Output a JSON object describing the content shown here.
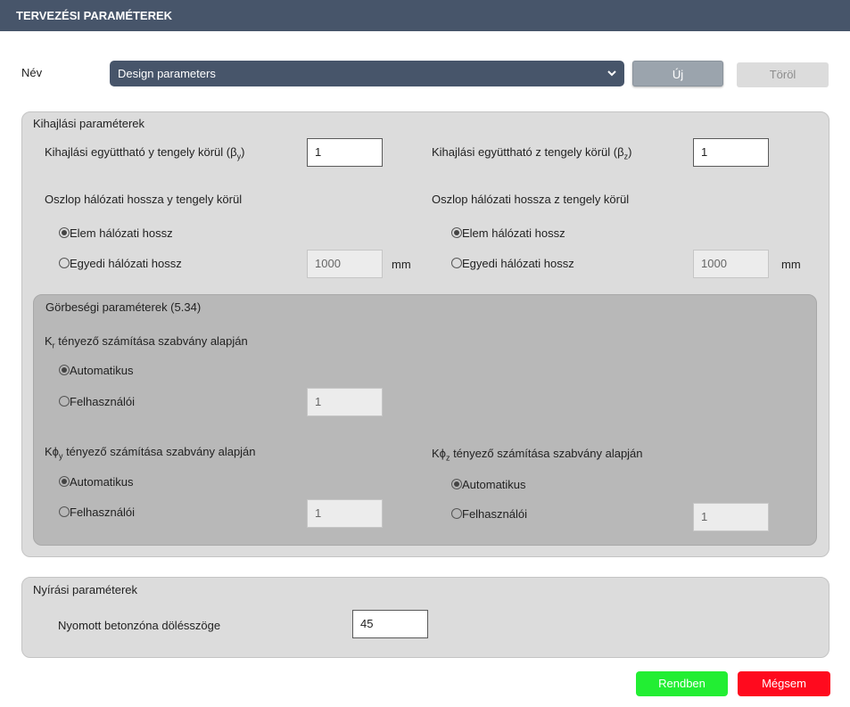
{
  "window": {
    "title": "TERVEZÉSI PARAMÉTEREK"
  },
  "name_row": {
    "label": "Név",
    "value": "Design parameters",
    "new_button": "Új",
    "delete_button": "Töröl"
  },
  "buckling": {
    "group_title": "Kihajlási paraméterek",
    "beta_y": {
      "label_prefix": "Kihajlási együttható y tengely körül (β",
      "sub": "y",
      "label_suffix": ")",
      "value": "1"
    },
    "beta_z": {
      "label_prefix": "Kihajlási együttható z tengely körül (β",
      "sub": "z",
      "label_suffix": ")",
      "value": "1"
    },
    "length_y": {
      "title": "Oszlop hálózati hossza y tengely körül",
      "option_elem": "Elem hálózati hossz",
      "option_custom": "Egyedi hálózati hossz",
      "custom_value": "1000",
      "unit": "mm",
      "selected": "elem"
    },
    "length_z": {
      "title": "Oszlop hálózati hossza z tengely körül",
      "option_elem": "Elem hálózati hossz",
      "option_custom": "Egyedi hálózati hossz",
      "custom_value": "1000",
      "unit": "mm",
      "selected": "elem"
    }
  },
  "curvature": {
    "group_title": "Görbeségi paraméterek (5.34)",
    "kr": {
      "prefix": "K",
      "sub": "r",
      "suffix": " tényező számítása szabvány alapján",
      "option_auto": "Automatikus",
      "option_user": "Felhasználói",
      "value": "1"
    },
    "kphi_y": {
      "prefix": "Kϕ",
      "sub": "y",
      "suffix": " tényező számítása szabvány alapján",
      "option_auto": "Automatikus",
      "option_user": "Felhasználói",
      "value": "1"
    },
    "kphi_z": {
      "prefix": "Kϕ",
      "sub": "z",
      "suffix": " tényező számítása szabvány alapján",
      "option_auto": "Automatikus",
      "option_user": "Felhasználói",
      "value": "1"
    }
  },
  "shear": {
    "group_title": "Nyírási paraméterek",
    "angle_label": "Nyomott betonzóna dölésszöge",
    "angle_value": "45"
  },
  "footer": {
    "ok": "Rendben",
    "cancel": "Mégsem"
  },
  "colors": {
    "titlebar": "#47556a",
    "ok": "#22ee33",
    "cancel": "#ff0a1e"
  },
  "icons": {
    "dropdown": "chevron-down-icon"
  }
}
